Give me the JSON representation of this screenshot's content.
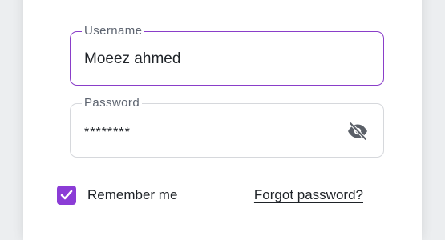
{
  "username": {
    "label": "Username",
    "value": "Moeez ahmed"
  },
  "password": {
    "label": "Password",
    "value": "********",
    "toggle_icon": "eye-off-icon"
  },
  "remember": {
    "label": "Remember me",
    "checked": true,
    "checkbox_icon": "checkmark-icon"
  },
  "forgot_password": {
    "label": "Forgot password?"
  },
  "colors": {
    "accent": "#8b3cd6",
    "focus_border": "#8a3ec9",
    "border": "#d6d8dc",
    "label_text": "#5d6470",
    "body_text": "#1f2328"
  }
}
